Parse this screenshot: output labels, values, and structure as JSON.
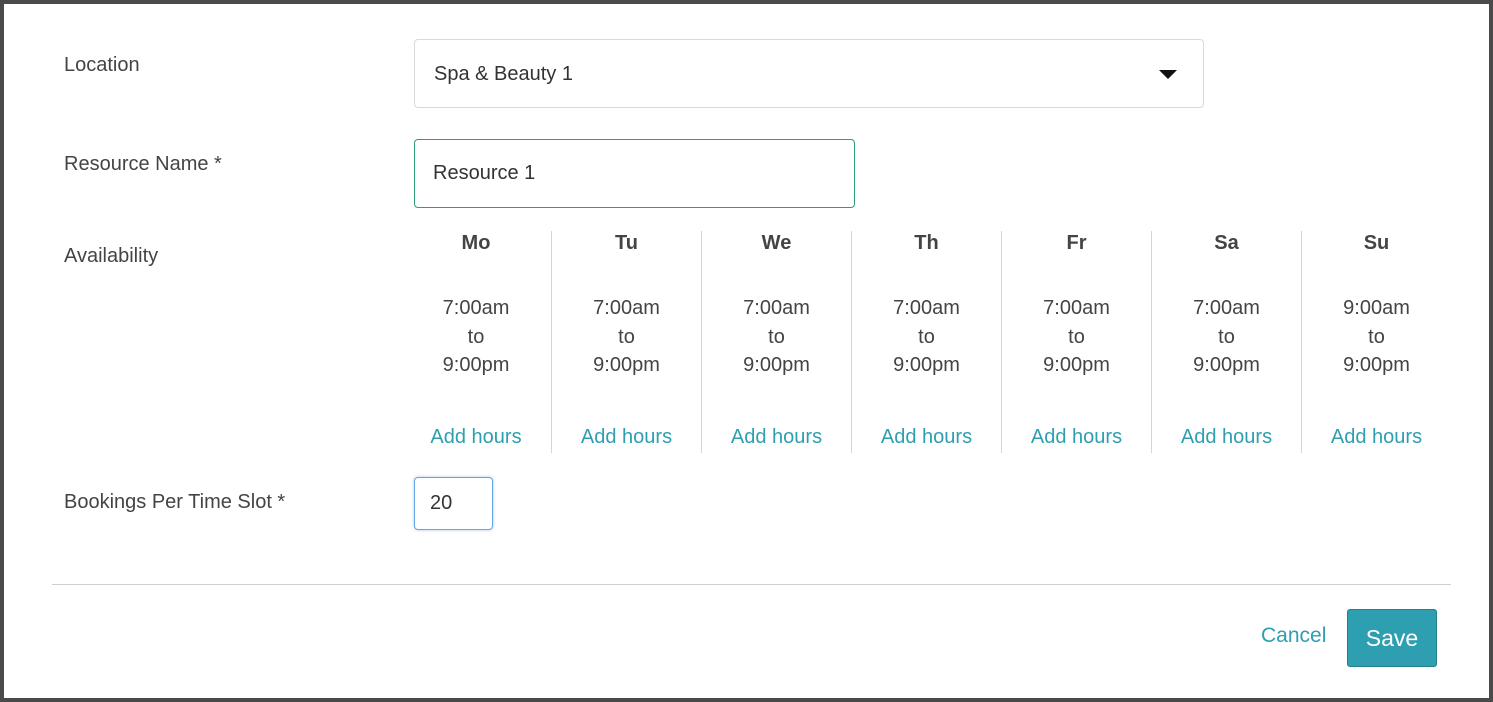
{
  "form": {
    "location_label": "Location",
    "location_value": "Spa & Beauty 1",
    "resource_name_label": "Resource Name *",
    "resource_name_value": "Resource 1",
    "availability_label": "Availability",
    "bookings_label": "Bookings Per Time Slot *",
    "bookings_value": "20"
  },
  "availability": {
    "days": [
      {
        "name": "Mo",
        "start": "7:00am",
        "sep": "to",
        "end": "9:00pm",
        "add": "Add hours"
      },
      {
        "name": "Tu",
        "start": "7:00am",
        "sep": "to",
        "end": "9:00pm",
        "add": "Add hours"
      },
      {
        "name": "We",
        "start": "7:00am",
        "sep": "to",
        "end": "9:00pm",
        "add": "Add hours"
      },
      {
        "name": "Th",
        "start": "7:00am",
        "sep": "to",
        "end": "9:00pm",
        "add": "Add hours"
      },
      {
        "name": "Fr",
        "start": "7:00am",
        "sep": "to",
        "end": "9:00pm",
        "add": "Add hours"
      },
      {
        "name": "Sa",
        "start": "7:00am",
        "sep": "to",
        "end": "9:00pm",
        "add": "Add hours"
      },
      {
        "name": "Su",
        "start": "9:00am",
        "sep": "to",
        "end": "9:00pm",
        "add": "Add hours"
      }
    ]
  },
  "footer": {
    "cancel_label": "Cancel",
    "save_label": "Save"
  },
  "colors": {
    "accent": "#2e9fb0",
    "input_border": "#2a9d7c",
    "focus_border": "#66a6e8"
  },
  "icons": {
    "location_dropdown": "caret-down-icon"
  }
}
